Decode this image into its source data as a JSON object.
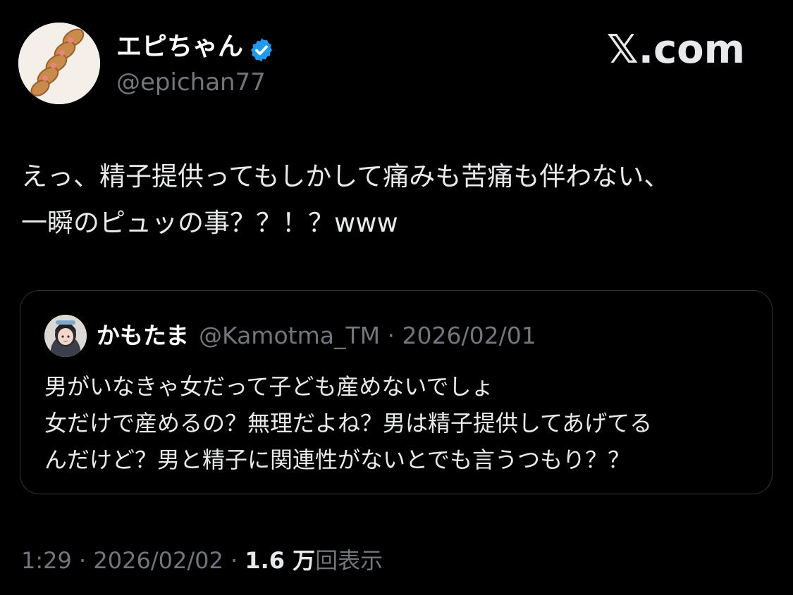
{
  "post": {
    "author": {
      "display_name": "エピちゃん",
      "handle": "@epichan77",
      "verified": true
    },
    "text_lines": [
      "えっ、精子提供ってもしかして痛みも苦痛も伴わない、",
      "一瞬のピュッの事？？！？www"
    ],
    "timestamp": "1:29 · 2026/02/02 · ",
    "views_count": "1.6 万",
    "views_label": "回表示"
  },
  "brand": {
    "wordmark": "𝕏.com"
  },
  "quote": {
    "display_name": "かもたま",
    "meta": "@Kamotma_TM · 2026/02/01",
    "text_lines": [
      "男がいなきゃ女だって子ども産めないでしょ",
      "女だけで産めるの？無理だよね？男は精子提供してあげてる",
      "んだけど？男と精子に関連性がないとでも言うつもり？？"
    ]
  },
  "colors": {
    "background": "#000000",
    "primary_text": "#e7e9ea",
    "secondary_text": "#71767b",
    "verified_blue": "#1d9bf0",
    "border": "#2f3336"
  },
  "icons": {
    "verified": "verified-badge-icon",
    "avatar": "avatar-image",
    "quote_avatar": "quote-avatar-image"
  }
}
